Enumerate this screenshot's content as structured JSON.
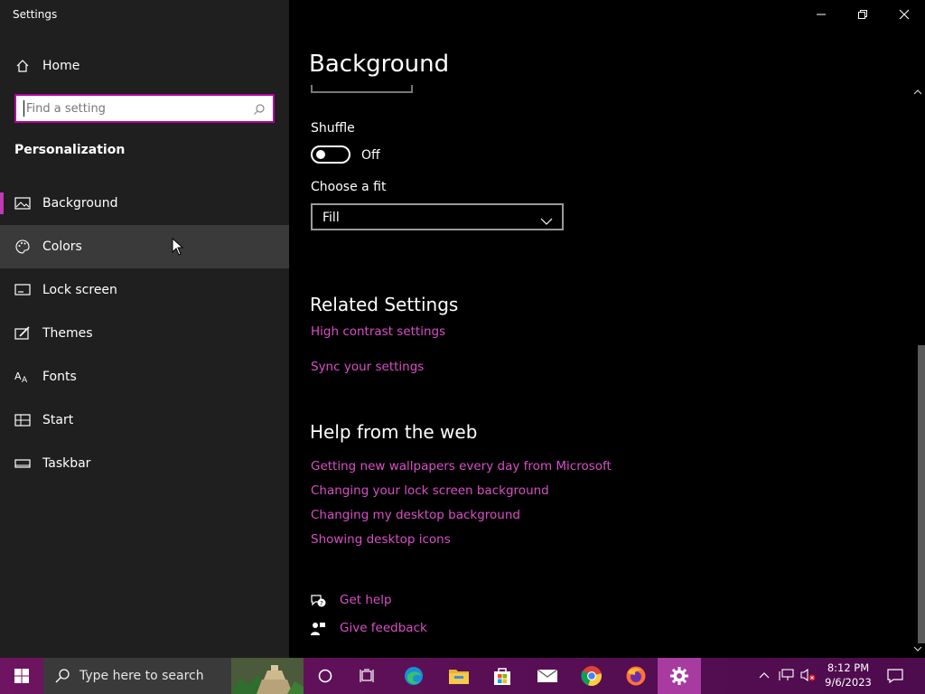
{
  "window": {
    "title": "Settings"
  },
  "sidebar": {
    "home_label": "Home",
    "search_placeholder": "Find a setting",
    "section_title": "Personalization",
    "items": [
      {
        "label": "Background",
        "icon": "picture-icon",
        "selected": true
      },
      {
        "label": "Colors",
        "icon": "palette-icon",
        "hover": true
      },
      {
        "label": "Lock screen",
        "icon": "lock-screen-icon"
      },
      {
        "label": "Themes",
        "icon": "themes-icon"
      },
      {
        "label": "Fonts",
        "icon": "fonts-icon"
      },
      {
        "label": "Start",
        "icon": "start-icon"
      },
      {
        "label": "Taskbar",
        "icon": "taskbar-icon"
      }
    ]
  },
  "main": {
    "title": "Background",
    "shuffle_label": "Shuffle",
    "shuffle_state": "Off",
    "fit_label": "Choose a fit",
    "fit_value": "Fill",
    "related_title": "Related Settings",
    "related_links": [
      "High contrast settings",
      "Sync your settings"
    ],
    "help_title": "Help from the web",
    "help_links": [
      "Getting new wallpapers every day from Microsoft",
      "Changing your lock screen background",
      "Changing my desktop background",
      "Showing desktop icons"
    ],
    "get_help": "Get help",
    "give_feedback": "Give feedback"
  },
  "taskbar": {
    "search_placeholder": "Type here to search",
    "time": "8:12 PM",
    "date": "9/6/2023"
  },
  "colors": {
    "accent": "#c239b3",
    "link": "#d94fc7",
    "sidebar_bg": "#1f1f1f",
    "content_bg": "#000000"
  }
}
